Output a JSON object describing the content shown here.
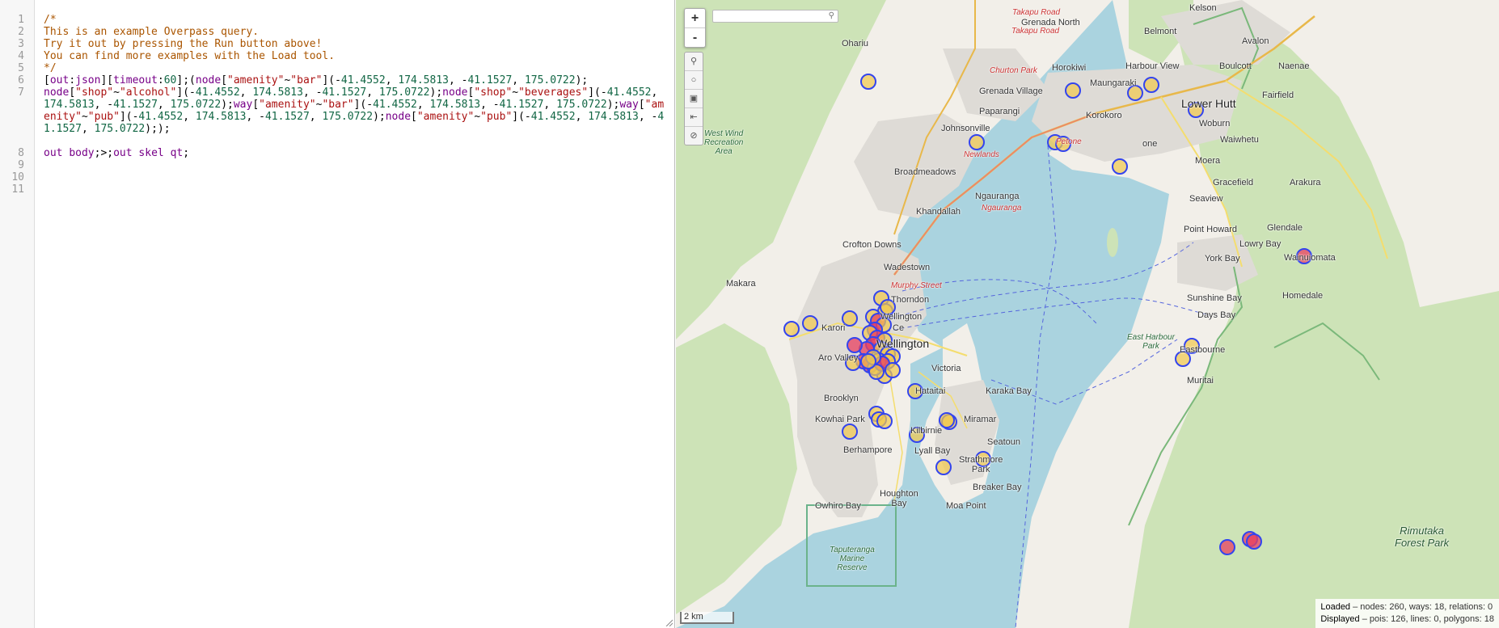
{
  "editor": {
    "line_numbers": [
      "1",
      "2",
      "3",
      "4",
      "5",
      "6",
      "7",
      "",
      "",
      "",
      "",
      "8",
      "9",
      "10",
      "11"
    ],
    "lines": {
      "l1": "/*",
      "l2": "This is an example Overpass query.",
      "l3": "Try it out by pressing the Run button above!",
      "l4": "You can find more examples with the Load tool.",
      "l5": "*/",
      "l6": "[out:json][timeout:60];(node[\"amenity\"~\"bar\"](-41.4552, 174.5813, -41.1527, 175.0722);",
      "l7": "node[\"shop\"~\"alcohol\"](-41.4552, 174.5813, -41.1527, 175.0722);node[\"shop\"~\"beverages\"](-41.4552, 174.5813, -41.1527, 175.0722);way[\"amenity\"~\"bar\"](-41.4552, 174.5813, -41.1527, 175.0722);way[\"amenity\"~\"pub\"](-41.4552, 174.5813, -41.1527, 175.0722);node[\"amenity\"~\"pub\"](-41.4552, 174.5813, -41.1527, 175.0722););",
      "l8": "out body;>;out skel qt;",
      "l9": "",
      "l10": "",
      "l11": ""
    }
  },
  "map": {
    "zoom_in": "+",
    "zoom_out": "-",
    "search_placeholder": "",
    "scale_label": "2 km",
    "stats_loaded_label": "Loaded",
    "stats_loaded": " – nodes: 260, ways: 18, relations: 0",
    "stats_displayed_label": "Displayed",
    "stats_displayed": " – pois: 126, lines: 0, polygons: 18",
    "tools": [
      "magnifier-icon",
      "circle-icon",
      "image-icon",
      "export-icon",
      "clear-icon"
    ],
    "labels": {
      "kelson": "Kelson",
      "takapu": "Takapu Road",
      "grenada_north": "Grenada North",
      "takapu2": "Takapu Road",
      "ohariu": "Ohariu",
      "belmont": "Belmont",
      "avalon": "Avalon",
      "churton": "Churton Park",
      "horokiwi": "Horokiwi",
      "harbour_view": "Harbour View",
      "boulcott": "Boulcott",
      "naenae": "Naenae",
      "grenada_village": "Grenada Village",
      "maungaraki": "Maungaraki",
      "lower_hutt": "Lower Hutt",
      "fairfield": "Fairfield",
      "paparangi": "Paparangi",
      "korokoro": "Korokoro",
      "woburn": "Woburn",
      "johnsonville": "Johnsonville",
      "petone": "Petone",
      "alicetown": "one",
      "waiwhetu": "Waiwhetu",
      "west_wind": "West Wind\nRecreation\nArea",
      "newlands": "Newlands",
      "moera": "Moera",
      "broadmeadows": "Broadmeadows",
      "gracefield": "Gracefield",
      "arakura": "Arakura",
      "ngauranga": "Ngauranga",
      "ngauranga_road": "Ngauranga",
      "seaview": "Seaview",
      "khandallah": "Khandallah",
      "point_howard": "Point Howard",
      "glendale": "Glendale",
      "crofton_downs": "Crofton Downs",
      "lowry_bay": "Lowry Bay",
      "york_bay": "York Bay",
      "wainuiomata": "Wainuiomata",
      "wadestown": "Wadestown",
      "makara": "Makara",
      "murphy": "Murphy Street",
      "sunshine_bay": "Sunshine Bay",
      "thorndon": "Thorndon",
      "homedale": "Homedale",
      "wellington_label": "Wellington",
      "centre": "Ce",
      "days_bay": "Days Bay",
      "karori": "Karori",
      "east_harbour": "East Harbour\nPark",
      "wellington_big": "Wellington",
      "aro_valley": "Aro Valley",
      "mount_victoria": "Victoria",
      "eastbourne": "Eastbourne",
      "muritai": "Muritai",
      "hataitai": "Hataitai",
      "karaka_bay": "Karaka Bay",
      "brooklyn": "Brooklyn",
      "kowhai_park": "Kowhai Park",
      "miramar": "Miramar",
      "kilbirnie": "Kilbirnie",
      "seatoun": "Seatoun",
      "berhampore": "Berhampore",
      "lyall_bay": "Lyall Bay",
      "strathmore": "Strathmore\nPark",
      "breaker_bay": "Breaker Bay",
      "owhiro_bay": "Owhiro Bay",
      "houghton_bay": "Houghton\nBay",
      "moa_point": "Moa Point",
      "rimutaka": "Rimutaka\nForest Park",
      "taputeranga": "Taputeranga\nMarine\nReserve"
    }
  },
  "colors": {
    "water": "#aad3df",
    "land": "#f2efe9",
    "green": "#c8dfb0",
    "urban": "#e0dedb",
    "poi_fill": "#f2c94c",
    "poi_stroke": "#3344ee",
    "poi_red": "#e84060"
  }
}
